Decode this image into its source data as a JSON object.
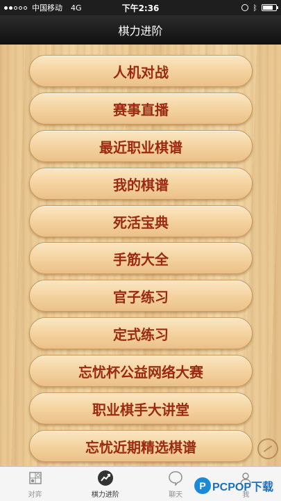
{
  "status_bar": {
    "carrier": "中国移动",
    "network": "4G",
    "time": "下午2:36"
  },
  "nav": {
    "title": "棋力进阶"
  },
  "menu": [
    {
      "label": "人机对战"
    },
    {
      "label": "赛事直播"
    },
    {
      "label": "最近职业棋谱"
    },
    {
      "label": "我的棋谱"
    },
    {
      "label": "死活宝典"
    },
    {
      "label": "手筋大全"
    },
    {
      "label": "官子练习"
    },
    {
      "label": "定式练习"
    },
    {
      "label": "忘忧杯公益网络大赛"
    },
    {
      "label": "职业棋手大讲堂"
    },
    {
      "label": "忘忧近期精选棋谱"
    }
  ],
  "tabs": [
    {
      "label": "对弈",
      "icon": "board-icon",
      "active": false
    },
    {
      "label": "棋力进阶",
      "icon": "trend-icon",
      "active": true
    },
    {
      "label": "聊天",
      "icon": "chat-icon",
      "active": false
    },
    {
      "label": "我",
      "icon": "person-icon",
      "active": false
    }
  ],
  "watermark": {
    "text": "PCPOP下载",
    "logo_letter": "P"
  },
  "colors": {
    "menu_text": "#9b2a12",
    "nav_bg": "#1a1a1a",
    "watermark_blue": "#1a8ad8"
  }
}
